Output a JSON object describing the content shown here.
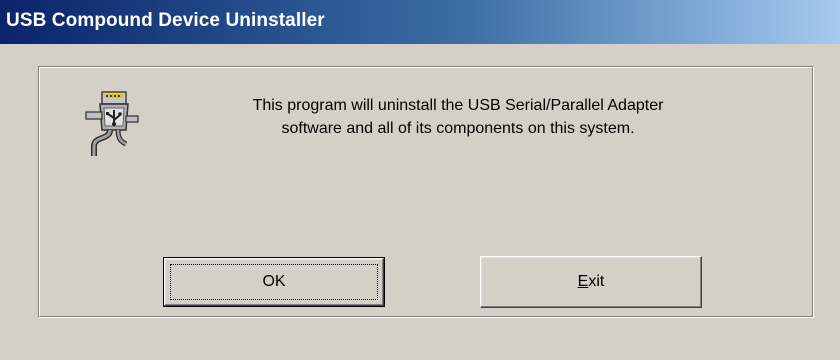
{
  "window": {
    "title": "USB Compound Device Uninstaller"
  },
  "dialog": {
    "icon": "usb-adapter-icon",
    "message_line1": "This program will uninstall the USB Serial/Parallel Adapter",
    "message_line2": "software and all of its components on this system."
  },
  "buttons": {
    "ok_label": "OK",
    "exit_mnemonic": "E",
    "exit_rest": "xit"
  },
  "colors": {
    "titlebar_start": "#0a246a",
    "titlebar_end": "#a6caf0",
    "face": "#d4d0c8"
  }
}
